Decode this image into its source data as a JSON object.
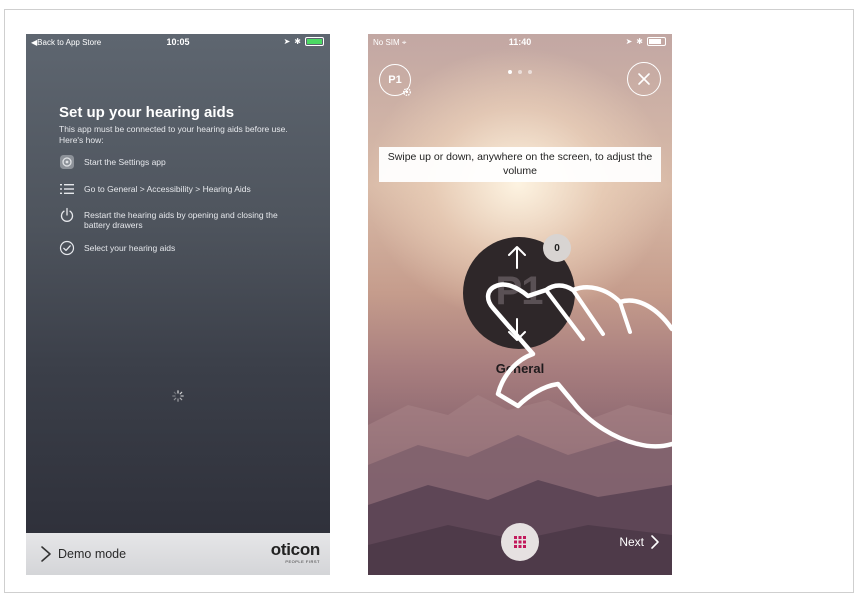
{
  "setup_screen": {
    "status_bar": {
      "back_link": "Back to App Store",
      "time": "10:05"
    },
    "title": "Set up your hearing aids",
    "description": "This app must be connected to your hearing aids before use. Here's how:",
    "steps": [
      {
        "icon": "settings-app-icon",
        "text": "Start the Settings app"
      },
      {
        "icon": "list-icon",
        "text": "Go to General > Accessibility > Hearing Aids"
      },
      {
        "icon": "power-icon",
        "text": "Restart the hearing aids by opening and closing the battery drawers"
      },
      {
        "icon": "check-circle-icon",
        "text": "Select your hearing aids"
      }
    ],
    "demo_mode_label": "Demo mode",
    "brand": {
      "name": "oticon",
      "tagline": "PEOPLE FIRST"
    }
  },
  "tutorial_screen": {
    "status_bar": {
      "carrier": "No SIM",
      "time": "11:40"
    },
    "page_dots": {
      "count": 3,
      "active": 0
    },
    "program_button": "P1",
    "instruction": "Swipe up or down, anywhere on the screen, to adjust the volume",
    "program_circle": "P1",
    "volume": "0",
    "program_name": "General",
    "next_label": "Next"
  },
  "colors": {
    "accent_magenta": "#c2185b",
    "battery_green": "#4cd964"
  }
}
